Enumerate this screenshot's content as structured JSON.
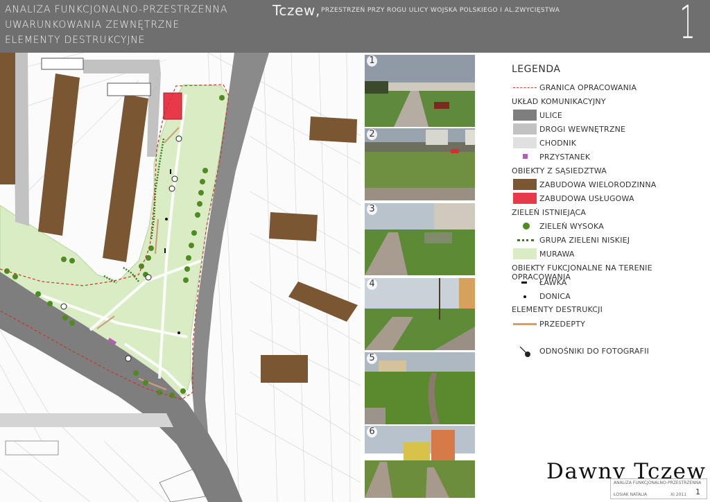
{
  "header": {
    "line1": "ANALIZA FUNKCJONALNO-PRZESTRZENNA",
    "line2": "UWARUNKOWANIA ZEWNĘTRZNE",
    "line3": "ELEMENTY DESTRUKCYJNE",
    "place": "Tczew,",
    "place_sub": "PRZESTRZEŃ PRZY ROGU ULICY WOJSKA POLSKIEGO I AL.ZWYCIĘSTWA",
    "sheet_number": "1"
  },
  "photos": [
    {
      "number": "1"
    },
    {
      "number": "2"
    },
    {
      "number": "3"
    },
    {
      "number": "4"
    },
    {
      "number": "5"
    },
    {
      "number": "6"
    }
  ],
  "legend": {
    "title": "LEGENDA",
    "border_label": "GRANICA OPRACOWANIA",
    "transport_heading": "UKŁAD KOMUNIKACYJNY",
    "streets": "ULICE",
    "internal_roads": "DROGI WEWNĘTRZNE",
    "sidewalk": "CHODNIK",
    "bus_stop": "PRZYSTANEK",
    "neighbors_heading": "OBIEKTY Z SĄSIEDZTWA",
    "multifamily": "ZABUDOWA WIELORODZINNA",
    "service": "ZABUDOWA USŁUGOWA",
    "greenery_heading": "ZIELEŃ ISTNIEJĄCA",
    "tall_greenery": "ZIELEŃ WYSOKA",
    "low_greenery": "GRUPA ZIELENI NISKIEJ",
    "lawn": "MURAWA",
    "functional_heading": "OBIEKTY FUKCJONALNE NA TERENIE OPRACOWANIA",
    "bench": "ŁAWKA",
    "flowerpot": "DONICA",
    "destructive_heading": "ELEMENTY DESTRUKCJI",
    "trails": "PRZEDEPTY",
    "photo_refs": "ODNOŚNIKI DO FOTOGRAFII"
  },
  "colors": {
    "header_bg": "#6f6f6f",
    "streets": "#7e7e7e",
    "internal_roads": "#c2c2c2",
    "sidewalk": "#e0e0e0",
    "bus_stop": "#b25fb0",
    "multifamily": "#7a5632",
    "service": "#e8394a",
    "tall_greenery": "#4f8a22",
    "lawn": "#d9ecc4",
    "trails": "#c9a27a",
    "border": "#c0392b"
  },
  "footer": {
    "brand": "Dawny Tczew",
    "tb_project": "ANALIZA FUNKCJONALNO-PRZESTRZENNA",
    "tb_author": "ŁOSIAK NATALIA",
    "tb_date": "XI 2011",
    "tb_sheet": "1"
  }
}
